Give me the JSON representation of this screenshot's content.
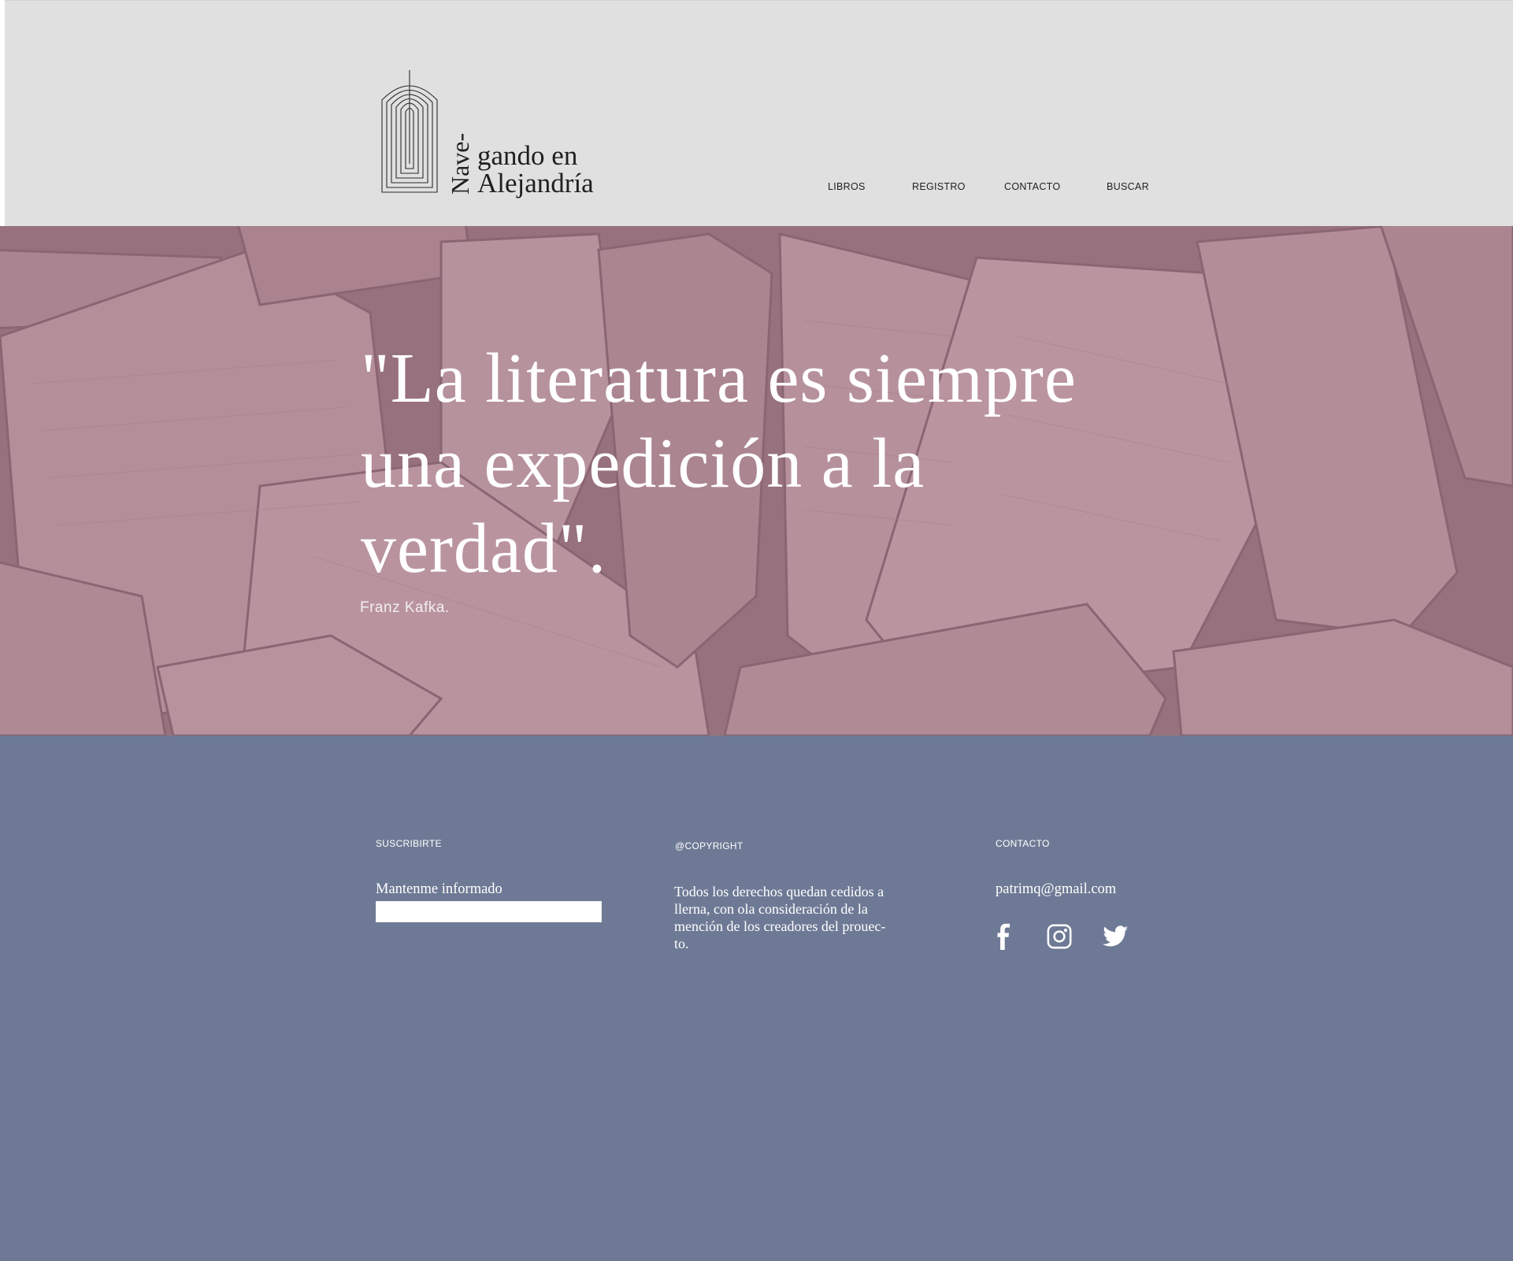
{
  "logo": {
    "vertical": "Nave-",
    "line1": "gando en",
    "line2": "Alejandría"
  },
  "nav": {
    "items": [
      "LIBROS",
      "REGISTRO",
      "CONTACTO",
      "BUSCAR"
    ]
  },
  "hero": {
    "quote_lines": [
      "\"La literatura es siempre",
      "una expedición a la",
      "verdad\"."
    ],
    "author": "Franz Kafka."
  },
  "footer": {
    "subscribe": {
      "heading": "SUSCRIBIRTE",
      "label": "Mantenme informado",
      "input_value": ""
    },
    "copyright": {
      "heading": "@COPYRIGHT",
      "lines": [
        "Todos los derechos quedan cedidos a",
        "llerna, con ola consideración de la",
        "mención de los creadores del prouec-",
        "to."
      ]
    },
    "contact": {
      "heading": "CONTACTO",
      "email": "patrimq@gmail.com",
      "social": [
        "facebook-icon",
        "instagram-icon",
        "twitter-icon"
      ]
    }
  },
  "colors": {
    "header_bg": "#e0e0e0",
    "hero_tint": "#a37c86",
    "footer_bg": "#6e7a95",
    "text_dark": "#1f1f1f",
    "text_light": "#ffffff"
  }
}
